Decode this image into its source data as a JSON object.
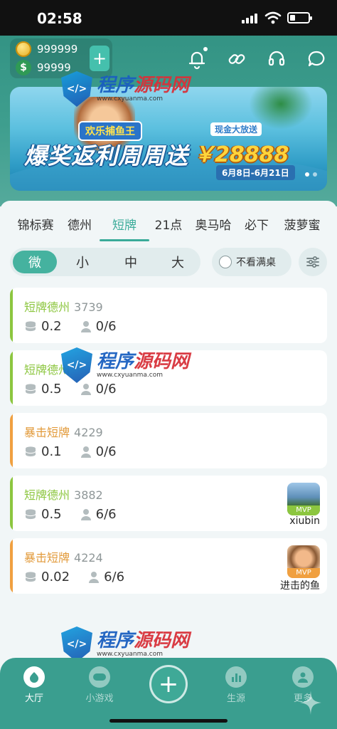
{
  "status": {
    "time": "02:58"
  },
  "wallet": {
    "coins": "999999",
    "cash": "99999",
    "cash_symbol": "$",
    "add_label": "+"
  },
  "banner": {
    "game_title": "欢乐捕鱼王",
    "cash_event": "现金大放送",
    "headline": "爆奖返利周周送",
    "amount": "￥28888",
    "dates": "6月8日-6月21日"
  },
  "tabs": [
    {
      "label": "锦标赛"
    },
    {
      "label": "德州"
    },
    {
      "label": "短牌"
    },
    {
      "label": "21点"
    },
    {
      "label": "奥马哈"
    },
    {
      "label": "必下"
    },
    {
      "label": "菠萝蜜"
    }
  ],
  "active_tab": "短牌",
  "stakes": [
    {
      "label": "微"
    },
    {
      "label": "小"
    },
    {
      "label": "中"
    },
    {
      "label": "大"
    }
  ],
  "active_stake": "微",
  "filter": {
    "not_full_label": "不看满桌"
  },
  "rooms": [
    {
      "name": "短牌德州",
      "id": "3739",
      "stake": "0.2",
      "players": "0/6",
      "accent": "#8cc63f",
      "name_color": "#8cc63f"
    },
    {
      "name": "短牌德州",
      "id": "",
      "stake": "0.5",
      "players": "0/6",
      "accent": "#8cc63f",
      "name_color": "#8cc63f"
    },
    {
      "name": "暴击短牌",
      "id": "4229",
      "stake": "0.1",
      "players": "0/6",
      "accent": "#f0a040",
      "name_color": "#e29a3a"
    },
    {
      "name": "短牌德州",
      "id": "3882",
      "stake": "0.5",
      "players": "6/6",
      "accent": "#8cc63f",
      "name_color": "#8cc63f",
      "mvp": {
        "badge": "MVP",
        "user": "xiubin",
        "badge_color": "#8cc63f"
      }
    },
    {
      "name": "暴击短牌",
      "id": "4224",
      "stake": "0.02",
      "players": "6/6",
      "accent": "#f0a040",
      "name_color": "#e29a3a",
      "mvp": {
        "badge": "MVP",
        "user": "进击的鱼",
        "badge_color": "#f0a040"
      }
    }
  ],
  "nav": [
    {
      "label": "大厅"
    },
    {
      "label": "小游戏"
    },
    {
      "label": "生源"
    },
    {
      "label": "更多"
    }
  ],
  "center_label": "+",
  "watermark": {
    "title_a": "程序",
    "title_b": "源码网",
    "url": "www.cxyuanma.com",
    "shield": "</>"
  }
}
